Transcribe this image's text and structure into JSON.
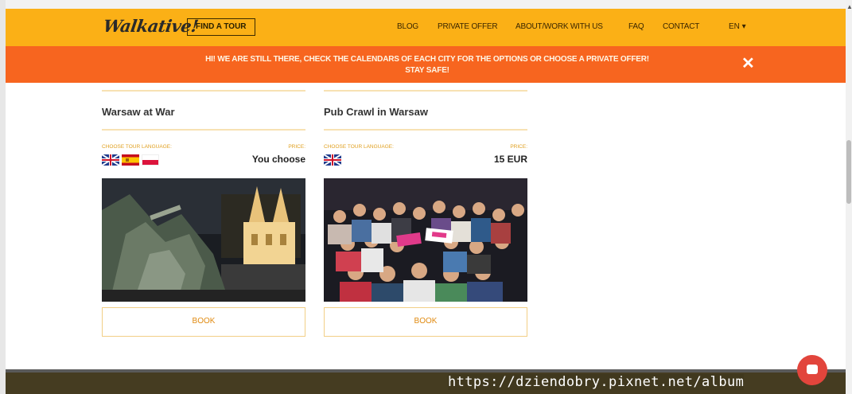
{
  "header": {
    "logo_text": "Walkative!",
    "find_tour_label": "FIND A TOUR",
    "nav_items": [
      "BLOG",
      "PRIVATE OFFER",
      "ABOUT/WORK WITH US",
      "FAQ",
      "CONTACT"
    ],
    "language_label": "EN ▾",
    "background_color": "#fbb016"
  },
  "notice": {
    "line1": "HI! WE ARE STILL THERE, CHECK THE CALENDARS OF EACH CITY FOR THE OPTIONS OR CHOOSE A PRIVATE OFFER!",
    "line2": "STAY SAFE!",
    "close_icon": "✕",
    "background_color": "#f7651f"
  },
  "tours": [
    {
      "title": "Warsaw at War",
      "language_label": "CHOOSE TOUR LANGUAGE:",
      "price_label": "PRICE:",
      "price_value": "You choose",
      "flags": [
        "uk-flag-icon",
        "spain-flag-icon",
        "poland-flag-icon"
      ],
      "image": "night-monument-photo",
      "book_label": "BOOK"
    },
    {
      "title": "Pub Crawl in Warsaw",
      "language_label": "CHOOSE TOUR LANGUAGE:",
      "price_label": "PRICE:",
      "price_value": "15 EUR",
      "flags": [
        "uk-flag-icon"
      ],
      "image": "pub-crawl-group-photo",
      "book_label": "BOOK"
    }
  ],
  "watermark": "https://dziendobry.pixnet.net/album",
  "chat_icon": "chat-bubble-icon"
}
